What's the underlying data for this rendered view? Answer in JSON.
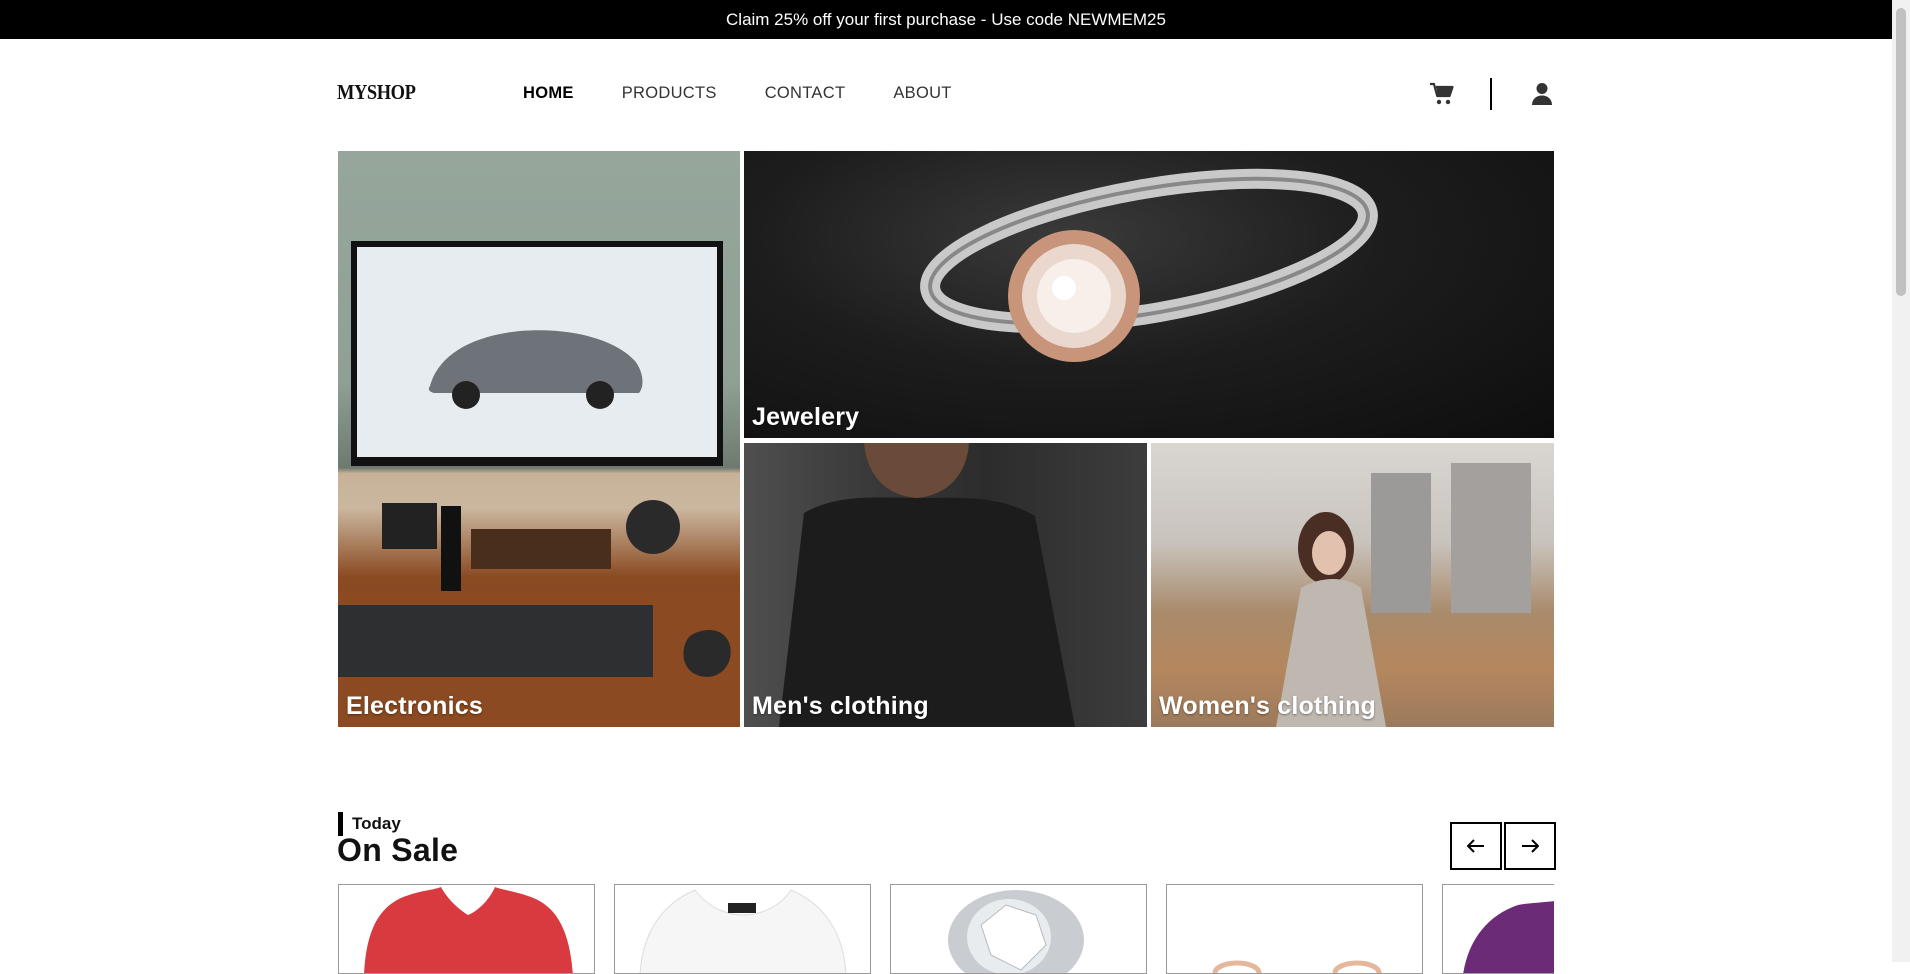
{
  "promo": {
    "text": "Claim 25% off your first purchase - Use code NEWMEM25"
  },
  "header": {
    "logo": "MYSHOP",
    "nav": [
      {
        "label": "HOME",
        "active": true
      },
      {
        "label": "PRODUCTS",
        "active": false
      },
      {
        "label": "CONTACT",
        "active": false
      },
      {
        "label": "ABOUT",
        "active": false
      }
    ],
    "icons": [
      "cart-icon",
      "user-icon"
    ]
  },
  "categories": [
    {
      "label": "Electronics"
    },
    {
      "label": "Jewelery"
    },
    {
      "label": "Men's clothing"
    },
    {
      "label": "Women's clothing"
    }
  ],
  "sale": {
    "subtitle": "Today",
    "title": "On Sale",
    "prev_icon": "arrow-left-icon",
    "next_icon": "arrow-right-icon",
    "products": [
      {
        "image": "red-shirt"
      },
      {
        "image": "white-top"
      },
      {
        "image": "diamond-ring"
      },
      {
        "image": "rings"
      },
      {
        "image": "purple-shirt"
      }
    ]
  },
  "colors": {
    "promo_bg": "#000000",
    "text": "#111111",
    "border": "#999999"
  }
}
